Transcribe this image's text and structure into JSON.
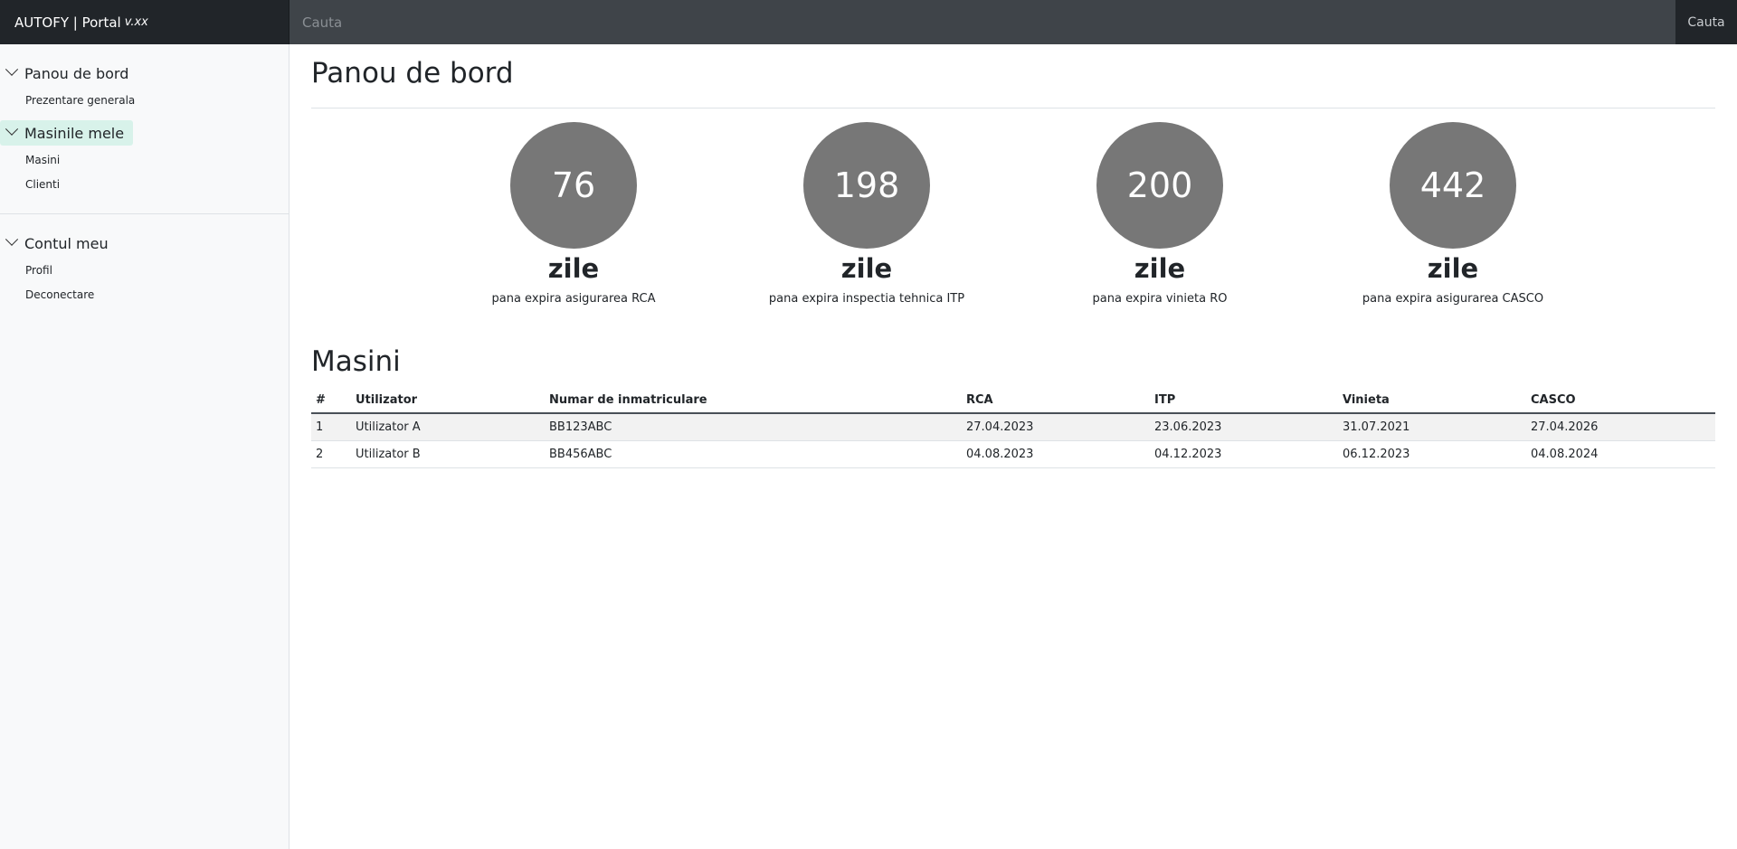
{
  "navbar": {
    "brand": "AUTOFY | Portal",
    "version": "v.xx",
    "search_placeholder": "Cauta",
    "action_label": "Cauta"
  },
  "sidebar": {
    "sections": [
      {
        "label": "Panou de bord",
        "items": [
          "Prezentare generala"
        ]
      },
      {
        "label": "Masinile mele",
        "items": [
          "Masini",
          "Clienti"
        ]
      },
      {
        "label": "Contul meu",
        "items": [
          "Profil",
          "Deconectare"
        ]
      }
    ]
  },
  "dashboard": {
    "title": "Panou de bord",
    "stats": [
      {
        "value": "76",
        "unit": "zile",
        "caption": "pana expira asigurarea RCA"
      },
      {
        "value": "198",
        "unit": "zile",
        "caption": "pana expira inspectia tehnica ITP"
      },
      {
        "value": "200",
        "unit": "zile",
        "caption": "pana expira vinieta RO"
      },
      {
        "value": "442",
        "unit": "zile",
        "caption": "pana expira asigurarea CASCO"
      }
    ]
  },
  "cars": {
    "title": "Masini",
    "columns": [
      "#",
      "Utilizator",
      "Numar de inmatriculare",
      "RCA",
      "ITP",
      "Vinieta",
      "CASCO"
    ],
    "rows": [
      [
        "1",
        "Utilizator A",
        "BB123ABC",
        "27.04.2023",
        "23.06.2023",
        "31.07.2021",
        "27.04.2026"
      ],
      [
        "2",
        "Utilizator B",
        "BB456ABC",
        "04.08.2023",
        "04.12.2023",
        "06.12.2023",
        "04.08.2024"
      ]
    ]
  },
  "colors": {
    "navbar_bg": "#343a40",
    "brand_bg": "#212529",
    "stat_circle": "#777777",
    "active_section_bg": "#d8f2ea"
  }
}
